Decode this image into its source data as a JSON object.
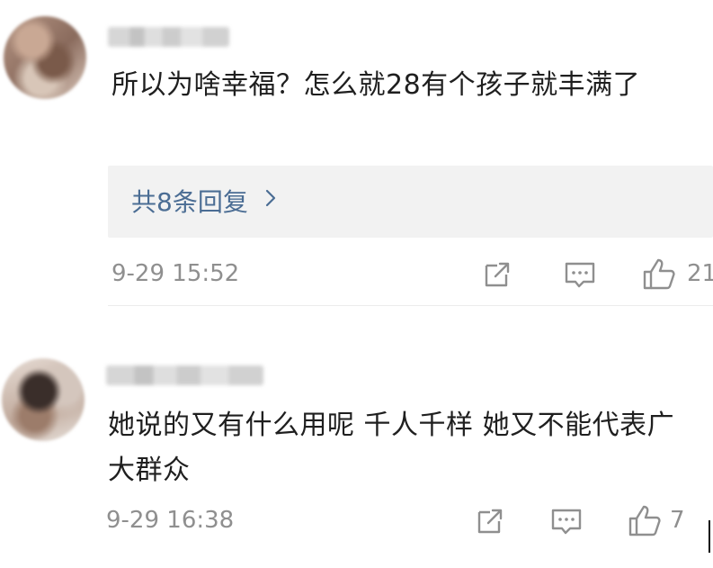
{
  "comments": [
    {
      "text": "所以为啥幸福？怎么就28有个孩子就丰满了",
      "reply_link": "共8条回复",
      "timestamp": "9-29 15:52",
      "likes": "21"
    },
    {
      "text": "她说的又有什么用呢 千人千样 她又不能代表广大群众",
      "timestamp": "9-29 16:38",
      "likes": "7"
    }
  ],
  "icons": {
    "share": "share-icon",
    "reply": "comment-icon",
    "like": "thumbs-up-icon",
    "chevron": "chevron-right-icon"
  },
  "colors": {
    "link": "#4b6d94",
    "meta": "#8f8f8f",
    "reply_box_bg": "#f2f2f2"
  }
}
